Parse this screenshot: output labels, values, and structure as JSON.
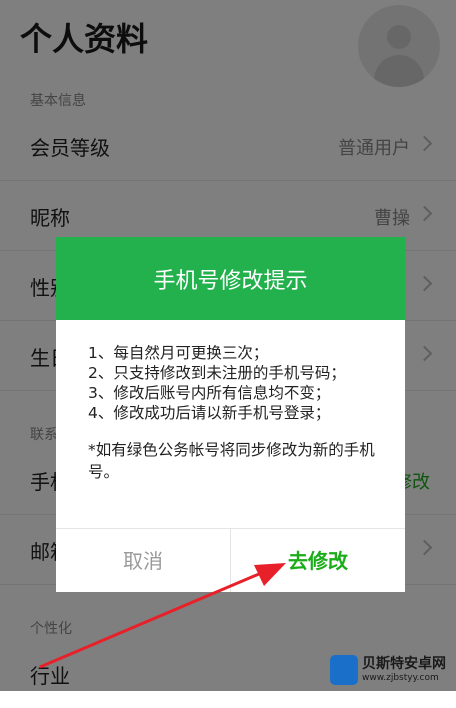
{
  "page": {
    "title": "个人资料",
    "section_basic": "基本信息",
    "section_contact": "联系",
    "section_personal": "个性化"
  },
  "rows": [
    {
      "label": "会员等级",
      "value": "普通用户"
    },
    {
      "label": "昵称",
      "value": "曹操"
    },
    {
      "label": "性别",
      "value": ""
    },
    {
      "label": "生日",
      "value": ""
    },
    {
      "label": "手机",
      "value": "修改"
    },
    {
      "label": "邮箱",
      "value": ""
    },
    {
      "label": "行业",
      "value": ""
    }
  ],
  "dialog": {
    "title": "手机号修改提示",
    "lines": [
      "1、每自然月可更换三次；",
      "2、只支持修改到未注册的手机号码；",
      "3、修改后账号内所有信息均不变；",
      "4、修改成功后请以新手机号登录；"
    ],
    "note": "*如有绿色公务帐号将同步修改为新的手机号。",
    "cancel_label": "取消",
    "confirm_label": "去修改"
  },
  "watermark": {
    "name": "贝斯特安卓网",
    "url": "www.zjbstyy.com"
  },
  "colors": {
    "header_green": "#22b14c",
    "confirm_green": "#1aad19",
    "arrow_red": "#e8202a"
  }
}
